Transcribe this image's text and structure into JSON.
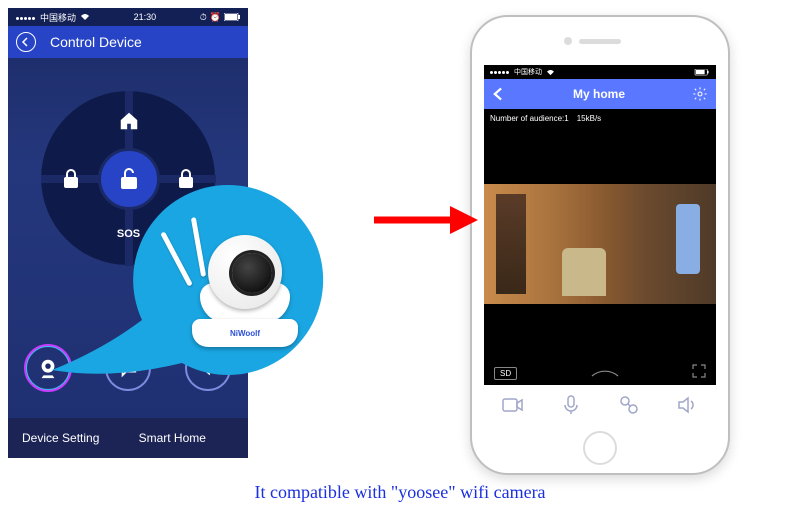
{
  "left": {
    "carrier": "中国移动",
    "time": "21:30",
    "nav_title": "Control Device",
    "dpad": {
      "sos": "SOS"
    },
    "footer": {
      "device_setting": "Device Setting",
      "smart_home": "Smart Home"
    }
  },
  "camera": {
    "brand": "NiWoolf"
  },
  "right": {
    "carrier": "中国移动",
    "nav_title": "My home",
    "audience_label": "Number of audience:1",
    "bitrate": "15kB/s",
    "quality_badge": "SD"
  },
  "caption": "It compatible with \"yoosee\" wifi camera"
}
